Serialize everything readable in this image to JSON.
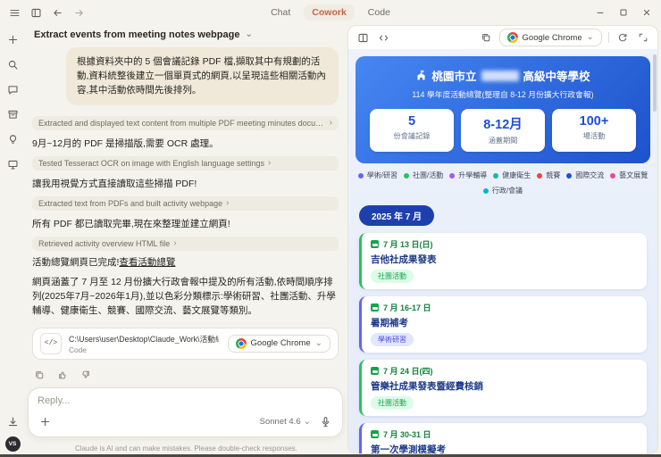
{
  "icons": {
    "chevron_down": "⌄",
    "chevron_right": "›",
    "code_glyph": "</>"
  },
  "topbar": {
    "tabs": [
      "Chat",
      "Cowork",
      "Code"
    ],
    "active_tab": "Cowork"
  },
  "rail": {
    "avatar_initials": "VS"
  },
  "chat": {
    "task_title": "Extract events from meeting notes webpage",
    "user_message": "根據資料夾中的 5 個會議記錄 PDF 檔,擷取其中有規劃的活動,資料統整後建立一個單頁式的網頁,以呈現這些相關活動內容,其中活動依時間先後排列。",
    "steps": [
      {
        "type": "tool",
        "label": "Extracted and displayed text content from multiple PDF meeting minutes documents"
      },
      {
        "type": "text",
        "label": "9月~12月的 PDF 是掃描版,需要 OCR 處理。"
      },
      {
        "type": "tool",
        "label": "Tested Tesseract OCR on image with English language settings"
      },
      {
        "type": "text",
        "label": "讓我用視覺方式直接讀取這些掃描 PDF!"
      },
      {
        "type": "tool",
        "label": "Extracted text from PDFs and built activity webpage"
      },
      {
        "type": "text",
        "label": "所有 PDF 都已讀取完畢,現在來整理並建立網頁!"
      },
      {
        "type": "tool",
        "label": "Retrieved activity overview HTML file"
      }
    ],
    "completion_text": "活動總覽網頁已完成!",
    "completion_link": "查看活動總覽",
    "summary": "網頁涵蓋了 7 月至 12 月份擴大行政會報中提及的所有活動,依時間順序排列(2025年7月~2026年1月),並以色彩分類標示:學術研習、社團活動、升學輔導、健康衛生、競賽、國際交流、藝文展覽等類別。",
    "file_card": {
      "path": "C:\\Users\\user\\Desktop\\Claude_Work\\活動總...",
      "type": "Code",
      "open_with": "Google Chrome"
    },
    "reply_placeholder": "Reply...",
    "model": "Sonnet 4.6",
    "disclaimer": "Claude is AI and can make mistakes. Please double-check responses."
  },
  "preview": {
    "browser": "Google Chrome",
    "page": {
      "school_prefix": "桃園市立",
      "school_suffix": "高級中等學校",
      "subtitle": "114 學年度活動總覽(整理自 8-12 月份擴大行政會報)",
      "stats": [
        {
          "value": "5",
          "label": "份會議記錄"
        },
        {
          "value": "8-12月",
          "label": "涵蓋期間"
        },
        {
          "value": "100+",
          "label": "場活動"
        }
      ],
      "legend": [
        {
          "label": "學術/研習",
          "color": "#6366f1"
        },
        {
          "label": "社團/活動",
          "color": "#22c55e"
        },
        {
          "label": "升學輔導",
          "color": "#a855f7"
        },
        {
          "label": "健康衛生",
          "color": "#14b8a6"
        },
        {
          "label": "競賽",
          "color": "#ef4444"
        },
        {
          "label": "國際交流",
          "color": "#1d4ed8"
        },
        {
          "label": "藝文展覽",
          "color": "#ec4899"
        },
        {
          "label": "行政/會議",
          "color": "#06b6d4"
        }
      ],
      "month_header": "2025 年 7 月",
      "events": [
        {
          "date": "7 月 13 日(日)",
          "title": "吉他社成果發表",
          "tag": "社團活動",
          "tag_color": "#16a34a",
          "tag_bg": "#dcfce7",
          "accent": "#22c55e"
        },
        {
          "date": "7 月 16-17 日",
          "title": "暑期補考",
          "tag": "學術研習",
          "tag_color": "#4f46e5",
          "tag_bg": "#e0e7ff",
          "accent": "#6366f1"
        },
        {
          "date": "7 月 24 日(四)",
          "title": "管樂社成果發表暨經費核銷",
          "tag": "社團活動",
          "tag_color": "#16a34a",
          "tag_bg": "#dcfce7",
          "accent": "#22c55e"
        },
        {
          "date": "7 月 30-31 日",
          "title": "第一次學測模擬考",
          "accent": "#6366f1"
        }
      ]
    }
  }
}
